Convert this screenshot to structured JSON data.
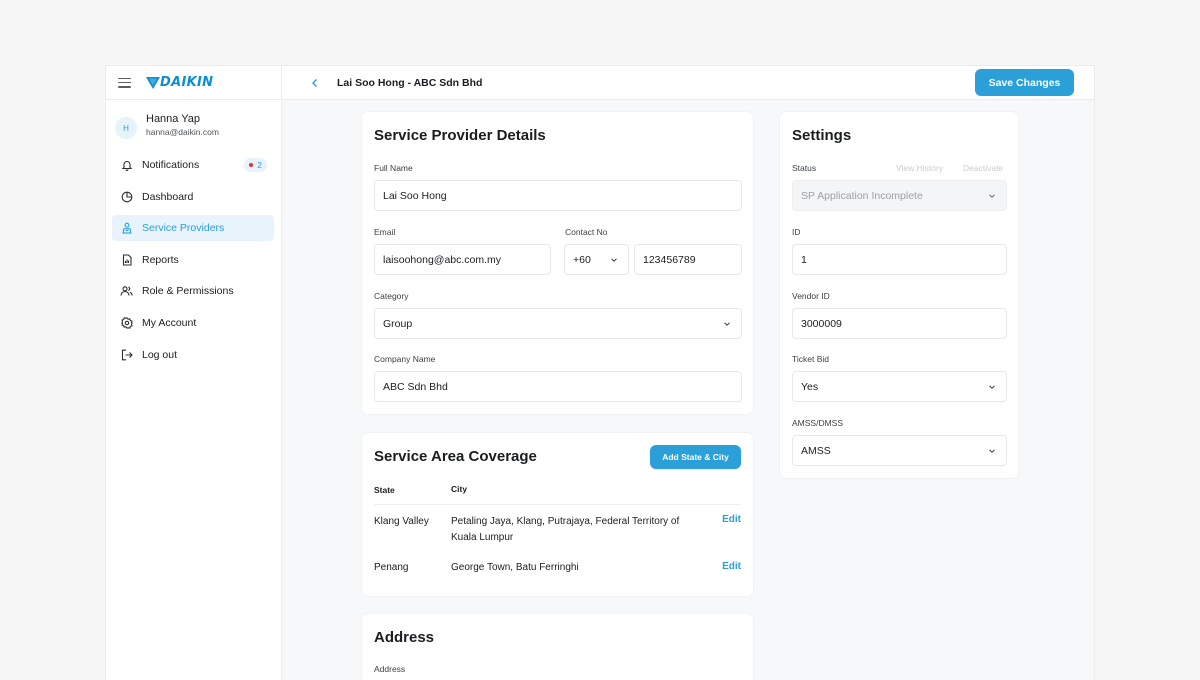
{
  "app": {
    "brand": "DAIKIN"
  },
  "user": {
    "initial": "H",
    "name": "Hanna Yap",
    "email": "hanna@daikin.com"
  },
  "nav": [
    {
      "label": "Notifications",
      "icon": "bell-icon",
      "badge": "2"
    },
    {
      "label": "Dashboard",
      "icon": "pie-chart-icon"
    },
    {
      "label": "Service Providers",
      "icon": "provider-icon",
      "active": true
    },
    {
      "label": "Reports",
      "icon": "report-icon"
    },
    {
      "label": "Role & Permissions",
      "icon": "users-icon"
    },
    {
      "label": "My Account",
      "icon": "gear-icon"
    },
    {
      "label": "Log out",
      "icon": "logout-icon"
    }
  ],
  "header": {
    "title": "Lai Soo Hong - ABC Sdn Bhd",
    "save_label": "Save Changes"
  },
  "details": {
    "title": "Service Provider Details",
    "full_name_label": "Full Name",
    "full_name": "Lai Soo Hong",
    "email_label": "Email",
    "email": "laisoohong@abc.com.my",
    "contact_label": "Contact No",
    "country_code": "+60",
    "phone": "123456789",
    "category_label": "Category",
    "category": "Group",
    "company_label": "Company Name",
    "company": "ABC Sdn Bhd"
  },
  "coverage": {
    "title": "Service Area Coverage",
    "add_label": "Add State & City",
    "col_state": "State",
    "col_city": "City",
    "rows": [
      {
        "state": "Klang Valley",
        "city": "Petaling Jaya, Klang, Putrajaya, Federal Territory of Kuala Lumpur",
        "action": "Edit"
      },
      {
        "state": "Penang",
        "city": "George Town, Batu Ferringhi",
        "action": "Edit"
      }
    ]
  },
  "address": {
    "title": "Address",
    "address_label": "Address"
  },
  "settings": {
    "title": "Settings",
    "status_label": "Status",
    "view_history": "View History",
    "deactivate": "Deactivate",
    "status": "SP Application Incomplete",
    "id_label": "ID",
    "id": "1",
    "vendor_label": "Vendor ID",
    "vendor_id": "3000009",
    "ticket_label": "Ticket Bid",
    "ticket_bid": "Yes",
    "amss_label": "AMSS/DMSS",
    "amss": "AMSS"
  },
  "colors": {
    "accent": "#2a9fd8",
    "brand": "#0a8fd6",
    "badge_dot": "#e5322d"
  }
}
